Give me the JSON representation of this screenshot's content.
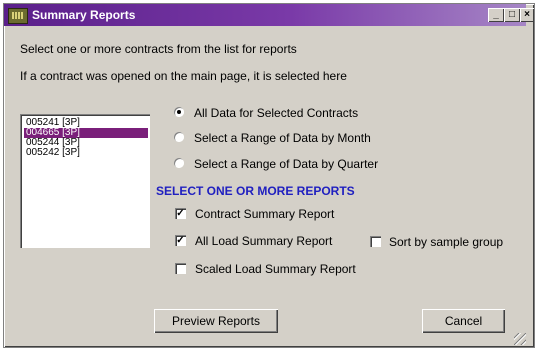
{
  "window": {
    "title": "Summary Reports",
    "controls": {
      "minimize": "_",
      "maximize": "□",
      "close": "×"
    }
  },
  "instructions": {
    "line1": "Select one or more contracts from the list for reports",
    "line2": "If a contract was opened on the main page, it is selected here"
  },
  "contracts": [
    {
      "label": "005241  [3P]",
      "selected": false
    },
    {
      "label": "004665  [3P]",
      "selected": true
    },
    {
      "label": "005244  [3P]",
      "selected": false
    },
    {
      "label": "005242  [3P]",
      "selected": false
    }
  ],
  "range_options": [
    {
      "label": "All Data for Selected Contracts",
      "checked": true
    },
    {
      "label": "Select a Range of Data by Month",
      "checked": false
    },
    {
      "label": "Select a Range of Data by Quarter",
      "checked": false
    }
  ],
  "reports": {
    "heading": "SELECT ONE OR MORE REPORTS",
    "contract_summary": {
      "label": "Contract Summary Report",
      "checked": true
    },
    "all_load_summary": {
      "label": "All Load Summary Report",
      "checked": true
    },
    "sort_by_sample_group": {
      "label": "Sort by sample group",
      "checked": false
    },
    "scaled_load_summary": {
      "label": "Scaled Load Summary Report",
      "checked": false
    }
  },
  "buttons": {
    "preview": "Preview Reports",
    "cancel": "Cancel"
  },
  "colors": {
    "title_gradient_start": "#5a1f8a",
    "selection": "#7a1f7a",
    "section_heading": "#2020c0"
  }
}
